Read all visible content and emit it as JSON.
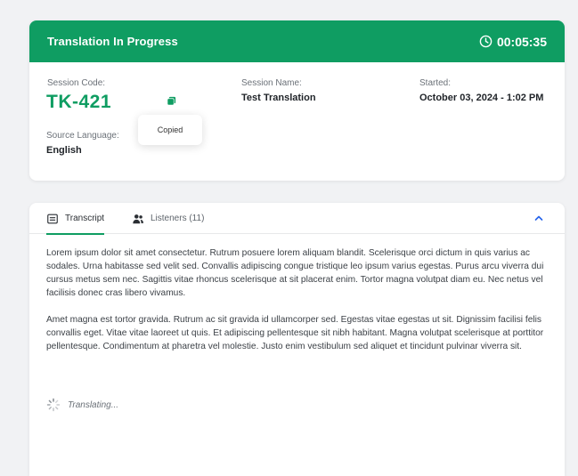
{
  "session": {
    "title": "Translation In Progress",
    "timer": "00:05:35",
    "code_label": "Session Code:",
    "code_value": "TK-421",
    "copied_tooltip": "Copied",
    "name_label": "Session Name:",
    "name_value": "Test Translation",
    "started_label": "Started:",
    "started_value": "October 03, 2024 - 1:02 PM",
    "source_label": "Source Language:",
    "source_value": "English"
  },
  "transcript": {
    "tabs": [
      {
        "label": "Transcript",
        "icon": "transcript-icon",
        "active": true
      },
      {
        "label": "Listeners (11)",
        "icon": "listeners-icon",
        "active": false
      }
    ],
    "paragraphs": [
      "Lorem ipsum dolor sit amet consectetur. Rutrum posuere lorem aliquam blandit. Scelerisque orci dictum in quis varius ac sodales. Urna habitasse sed velit sed. Convallis adipiscing congue tristique leo ipsum varius egestas. Purus arcu viverra dui cursus metus sem nec. Sagittis vitae rhoncus scelerisque at sit placerat enim. Tortor magna volutpat diam eu. Nec netus vel facilisis donec cras libero vivamus.",
      "Amet magna est tortor gravida. Rutrum ac sit gravida id ullamcorper sed. Egestas vitae egestas ut sit. Dignissim facilisi felis convallis eget. Vitae vitae laoreet ut quis. Et adipiscing pellentesque sit nibh habitant. Magna volutpat scelerisque at porttitor pellentesque. Condimentum at pharetra vel molestie. Justo enim vestibulum sed aliquet et tincidunt pulvinar viverra sit."
    ],
    "status": "Translating..."
  },
  "colors": {
    "accent": "#0f9d62",
    "background": "#f1f2f4"
  }
}
